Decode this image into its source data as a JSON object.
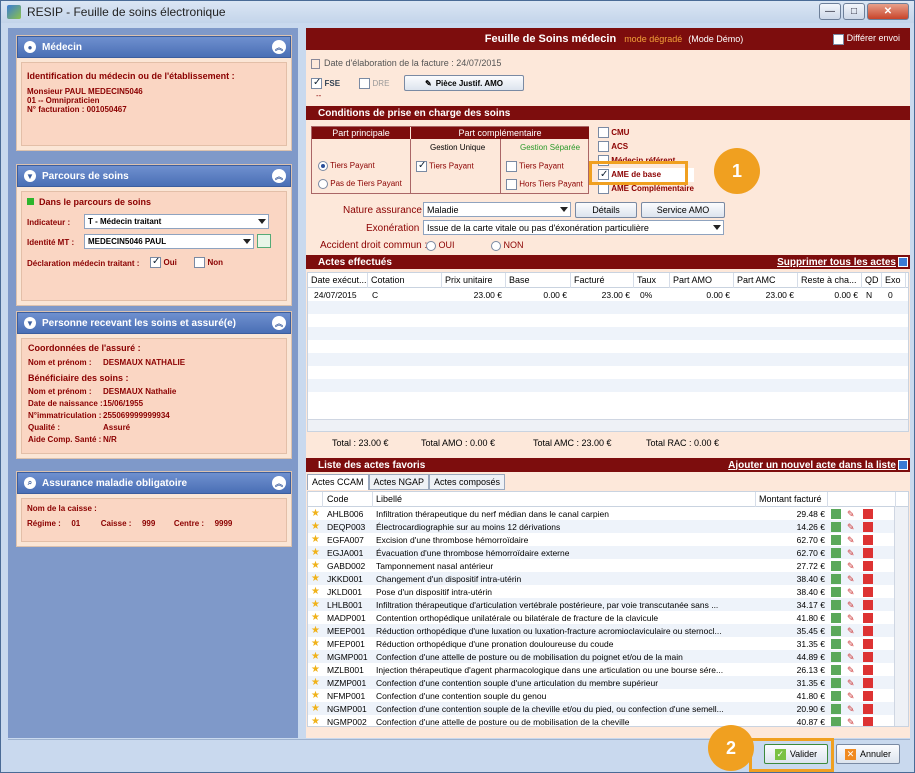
{
  "window": {
    "title": "RESIP - Feuille de soins électronique",
    "min": "—",
    "max": "□",
    "close": "✕"
  },
  "medecin": {
    "header": "Médecin",
    "section": "Identification du médecin ou de l'établissement :",
    "name": "Monsieur PAUL MEDECIN5046",
    "spec": "01 -- Omnipraticien",
    "fact": "N° facturation : 001050467"
  },
  "parcours": {
    "header": "Parcours de soins",
    "status": "Dans le parcours de soins",
    "indicateur_label": "Indicateur :",
    "indicateur_value": "T - Médecin traitant",
    "mt_label": "Identité MT :",
    "mt_value": "MEDECIN5046 PAUL",
    "decl_label": "Déclaration médecin traitant :",
    "oui": "Oui",
    "non": "Non"
  },
  "personne": {
    "header": "Personne recevant les soins et assuré(e)",
    "coord_title": "Coordonnées de l'assuré :",
    "nom_label": "Nom et prénom :",
    "nom_value": "DESMAUX NATHALIE",
    "benef_title": "Bénéficiaire des soins :",
    "bnom_label": "Nom et prénom :",
    "bnom_value": "DESMAUX Nathalie",
    "naiss_label": "Date de naissance :",
    "naiss_value": "15/06/1955",
    "immat_label": "N°immatriculation :",
    "immat_value": "255069999999934",
    "qual_label": "Qualité :",
    "qual_value": "Assuré",
    "acs_label": "Aide Comp. Santé :",
    "acs_value": "N/R"
  },
  "amo": {
    "header": "Assurance maladie obligatoire",
    "caisse_label": "Nom de la caisse :",
    "regime_label": "Régime :",
    "regime_value": "01",
    "caisse2_label": "Caisse :",
    "caisse2_value": "999",
    "centre_label": "Centre :",
    "centre_value": "9999"
  },
  "fsm": {
    "title": "Feuille de Soins médecin",
    "mode": "mode dégradé",
    "demo": "(Mode Démo)",
    "differer": "Différer envoi",
    "date": "Date d'élaboration de la facture : 24/07/2015",
    "fse": "FSE",
    "dre": "DRE",
    "dashes": "--",
    "piece_btn": "Pièce Justif. AMO"
  },
  "conditions": {
    "header": "Conditions de prise en charge des soins",
    "part_principale": "Part principale",
    "part_comp": "Part complémentaire",
    "gestion_unique": "Gestion Unique",
    "gestion_separee": "Gestion Séparée",
    "tiers_payant": "Tiers Payant",
    "pas_tp": "Pas de Tiers Payant",
    "tp2": "Tiers Payant",
    "tp3": "Tiers Payant",
    "hors_tp": "Hors Tiers Payant",
    "cmu": "CMU",
    "acs": "ACS",
    "medecin_referent": "Médecin référent",
    "ame_base": "AME de base",
    "ame_comp": "AME Complémentaire",
    "nature_label": "Nature assurance :",
    "nature_value": "Maladie",
    "details_btn": "Détails",
    "service_btn": "Service AMO",
    "exo_label": "Exonération :",
    "exo_value": "Issue de la carte vitale ou pas d'éxonération particulière",
    "accident_label": "Accident droit commun :",
    "oui": "OUI",
    "non": "NON"
  },
  "actes": {
    "header": "Actes effectués",
    "delete_all": "Supprimer tous les actes",
    "columns": [
      "Date exécut...",
      "Cotation",
      "Prix unitaire",
      "Base",
      "Facturé",
      "Taux",
      "Part AMO",
      "Part AMC",
      "Reste à cha...",
      "QD",
      "Exo"
    ],
    "rows": [
      [
        "24/07/2015",
        "C",
        "23.00 €",
        "0.00 €",
        "23.00 €",
        "0%",
        "0.00 €",
        "23.00 €",
        "0.00 €",
        "N",
        "0"
      ]
    ],
    "total": "Total : 23.00 €",
    "total_amo": "Total AMO : 0.00 €",
    "total_amc": "Total AMC : 23.00 €",
    "total_rac": "Total RAC : 0.00 €"
  },
  "favoris": {
    "header": "Liste des actes favoris",
    "add": "Ajouter un nouvel acte dans la liste",
    "tabs": [
      "Actes CCAM",
      "Actes NGAP",
      "Actes composés"
    ],
    "columns": [
      "Code",
      "Libellé",
      "Montant facturé"
    ],
    "rows": [
      [
        "AHLB006",
        "Infiltration thérapeutique du nerf médian dans le canal carpien",
        "29.48 €"
      ],
      [
        "DEQP003",
        "Électrocardiographie sur au moins 12 dérivations",
        "14.26 €"
      ],
      [
        "EGFA007",
        "Excision d'une thrombose hémorroïdaire",
        "62.70 €"
      ],
      [
        "EGJA001",
        "Évacuation d'une thrombose hémorroïdaire externe",
        "62.70 €"
      ],
      [
        "GABD002",
        "Tamponnement nasal antérieur",
        "27.72 €"
      ],
      [
        "JKKD001",
        "Changement d'un dispositif intra-utérin",
        "38.40 €"
      ],
      [
        "JKLD001",
        "Pose d'un dispositif intra-utérin",
        "38.40 €"
      ],
      [
        "LHLB001",
        "Infiltration thérapeutique d'articulation vertébrale postérieure, par voie transcutanée sans ...",
        "34.17 €"
      ],
      [
        "MADP001",
        "Contention orthopédique unilatérale ou bilatérale de fracture de la clavicule",
        "41.80 €"
      ],
      [
        "MEEP001",
        "Réduction orthopédique d'une luxation ou luxation-fracture acromioclaviculaire ou sternocl...",
        "35.45 €"
      ],
      [
        "MFEP001",
        "Réduction orthopédique d'une pronation douloureuse du coude",
        "31.35 €"
      ],
      [
        "MGMP001",
        "Confection d'une attelle de posture ou de mobilisation du poignet et/ou de la main",
        "44.89 €"
      ],
      [
        "MZLB001",
        "Injection thérapeutique d'agent pharmacologique dans une articulation ou une bourse sére...",
        "26.13 €"
      ],
      [
        "MZMP001",
        "Confection d'une contention souple d'une articulation du membre supérieur",
        "31.35 €"
      ],
      [
        "NFMP001",
        "Confection d'une contention souple du genou",
        "41.80 €"
      ],
      [
        "NGMP001",
        "Confection d'une contention souple de la cheville et/ou du pied, ou confection d'une semell...",
        "20.90 €"
      ],
      [
        "NGMP002",
        "Confection d'une attelle de posture ou de mobilisation de la cheville",
        "40.87 €"
      ]
    ]
  },
  "footer": {
    "valider": "Valider",
    "annuler": "Annuler"
  },
  "callouts": {
    "one": "1",
    "two": "2"
  },
  "colors": {
    "accent": "#f0a020",
    "redbar": "#7d0d0d",
    "panel_blue": "#4a6fb5"
  }
}
